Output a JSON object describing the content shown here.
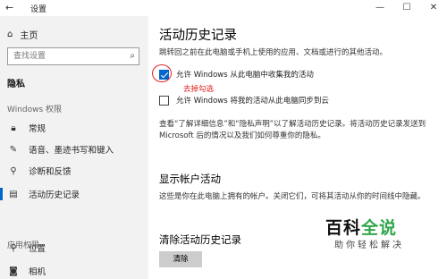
{
  "window": {
    "title": "设置",
    "back_glyph": "←",
    "min_glyph": "—",
    "max_glyph": "☐",
    "close_glyph": "✕"
  },
  "sidebar": {
    "home_label": "主页",
    "search_placeholder": "查找设置",
    "section_privacy": "隐私",
    "section_windows_permissions": "Windows 权限",
    "section_app_permissions": "应用权限",
    "items": [
      {
        "label": "常规",
        "icon": "lock-icon"
      },
      {
        "label": "语音、墨迹书写和键入",
        "icon": "ink-icon"
      },
      {
        "label": "诊断和反馈",
        "icon": "feedback-icon"
      },
      {
        "label": "活动历史记录",
        "icon": "history-icon",
        "selected": true
      }
    ],
    "app_items": [
      {
        "label": "位置",
        "icon": "location-icon"
      },
      {
        "label": "相机",
        "icon": "camera-icon"
      }
    ]
  },
  "main": {
    "title": "活动历史记录",
    "description": "跳转回之前在此电脑或手机上使用的应用、文档或进行的其他活动。",
    "checkbox1": {
      "label": "允许 Windows 从此电脑中收集我的活动",
      "checked": true
    },
    "annotation": "去掉勾选",
    "checkbox2": {
      "label": "允许 Windows 将我的活动从此电脑同步到云",
      "checked": false
    },
    "info_paragraph": "查看“了解详细信息”和“隐私声明”以了解活动历史记录。将活动历史记录发送到 Microsoft 后的情况以及我们如何尊重你的隐私。",
    "show_accounts_title": "显示帐户活动",
    "show_accounts_desc": "这些是你在此电脑上拥有的帐户。关闭它们，可将其活动从你的时间线中隐藏。",
    "clear_title": "清除活动历史记录",
    "clear_button": "清除"
  },
  "watermark": {
    "logo_text_a": "百科",
    "logo_text_b": "全说",
    "subtitle": "助你轻松解决"
  },
  "colors": {
    "accent": "#0066cc",
    "annotation": "#e02020",
    "watermark_green": "#2fa64a"
  }
}
